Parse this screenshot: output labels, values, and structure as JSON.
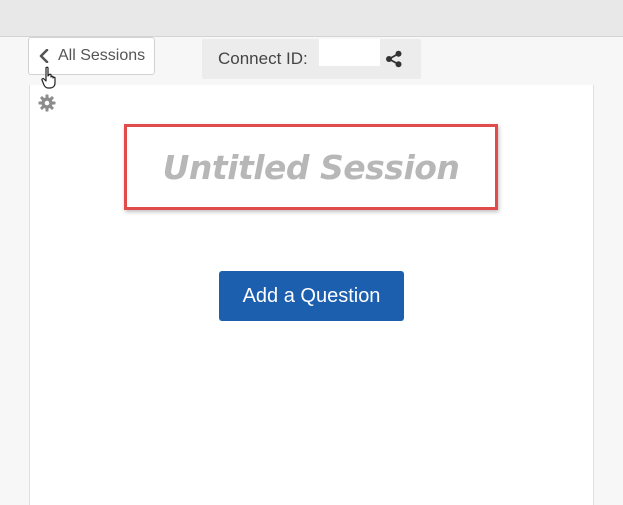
{
  "nav": {
    "back_label": "All Sessions",
    "back_icon": "chevron-left-icon"
  },
  "connect": {
    "label": "Connect ID:",
    "value": "",
    "share_icon": "share-icon"
  },
  "settings": {
    "icon": "gear-icon"
  },
  "session": {
    "title_placeholder": "Untitled Session"
  },
  "actions": {
    "add_question_label": "Add a Question"
  },
  "colors": {
    "accent_button": "#1b5fae",
    "highlight_border": "#e04b4b",
    "placeholder_text": "#b7b7b7"
  }
}
